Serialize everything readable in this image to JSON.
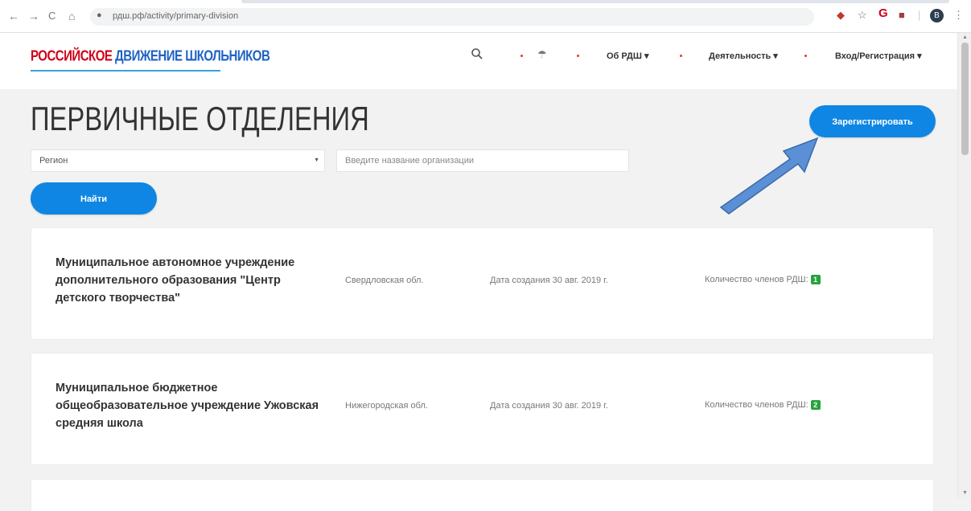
{
  "browser": {
    "url": "рдш.рф/activity/primary-division",
    "back_icon": "←",
    "forward_icon": "→",
    "reload_icon": "C",
    "home_icon": "⌂",
    "star_icon": "☆",
    "profile_letter": "B"
  },
  "header": {
    "logo_part1": "РОССИЙСКОЕ",
    "logo_part2": "ДВИЖЕНИЕ ШКОЛЬНИКОВ",
    "nav": {
      "about": "Об РДШ ▾",
      "activity": "Деятельность ▾",
      "login": "Вход/Регистрация ▾"
    }
  },
  "main": {
    "title": "ПЕРВИЧНЫЕ ОТДЕЛЕНИЯ",
    "register_label": "Зарегистрировать",
    "region_select": "Регион",
    "org_placeholder": "Введите название организации",
    "find_label": "Найти"
  },
  "cards": [
    {
      "name_lines": [
        "Муниципальное автономное учреждение",
        "дополнительного образования \"Центр",
        "детского творчества\""
      ],
      "region": "Свердловская обл.",
      "date": "Дата создания 30 авг. 2019 г.",
      "members_label": "Количество членов РДШ:",
      "members_count": "1"
    },
    {
      "name_lines": [
        "Муниципальное бюджетное",
        "общеобразовательное учреждение Ужовская",
        "средняя школа"
      ],
      "region": "Нижегородская обл.",
      "date": "Дата создания 30 авг. 2019 г.",
      "members_label": "Количество членов РДШ:",
      "members_count": "2"
    }
  ],
  "colors": {
    "primary_button": "#0f86e3",
    "badge": "#26a33d",
    "logo_red": "#d0021b",
    "logo_blue": "#1e62c5",
    "arrow": "#5b8fd6"
  }
}
